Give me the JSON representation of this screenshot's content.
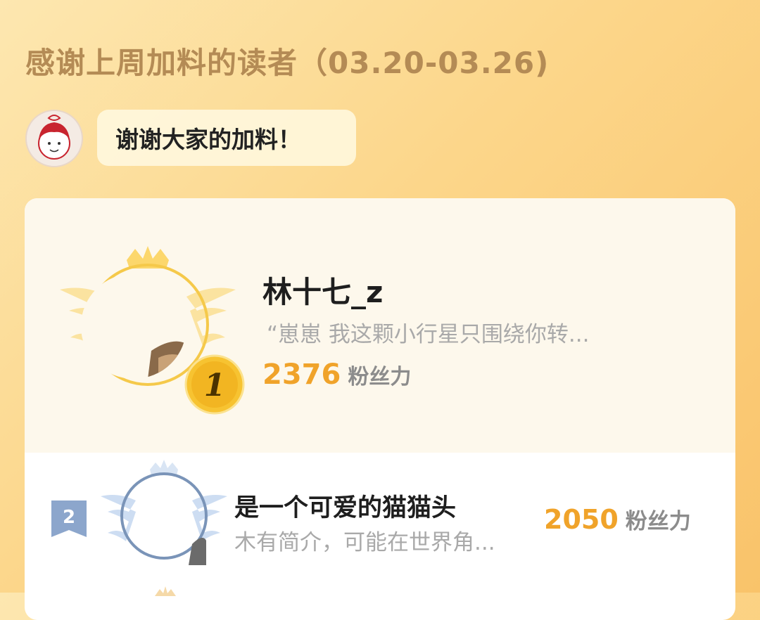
{
  "header": {
    "title": "感谢上周加料的读者（03.20-03.26)"
  },
  "author_message": {
    "text": "谢谢大家的加料！"
  },
  "leaderboard": [
    {
      "rank": "1",
      "name": "林十七_z",
      "bio": "“崽崽 我这颗小行星只围绕你转...",
      "score": "2376",
      "score_unit": "粉丝力"
    },
    {
      "rank": "2",
      "name": "是一个可爱的猫猫头",
      "bio": "木有简介，可能在世界角...",
      "score": "2050",
      "score_unit": "粉丝力"
    }
  ],
  "colors": {
    "accent_gold": "#f0a32a",
    "title_brown": "#b48b55",
    "silver_blue": "#7a94b8"
  }
}
